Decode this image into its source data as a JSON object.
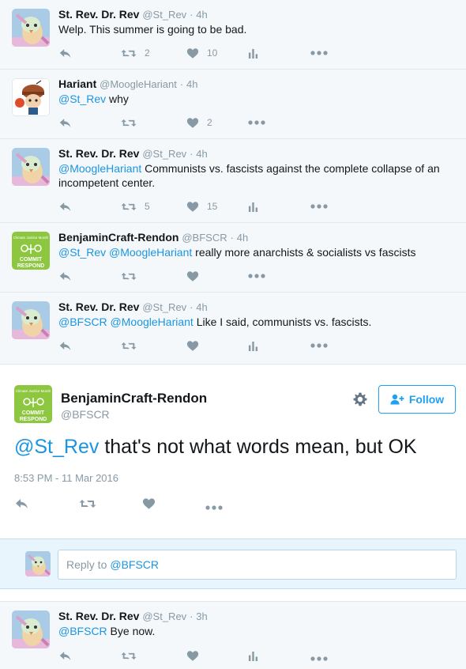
{
  "colors": {
    "link": "#1b95e0",
    "muted": "#8899a6",
    "follow": "#1da1f2",
    "background": "#f5f8fa"
  },
  "tweets_before": [
    {
      "avatar": "chick-avatar",
      "name": "St. Rev. Dr. Rev",
      "handle": "@St_Rev",
      "time": "4h",
      "mention": "",
      "text": "Welp. This summer is going to be bad.",
      "retweets": "2",
      "likes": "10",
      "analytics": true
    },
    {
      "avatar": "cartoon-avatar",
      "name": "Hariant",
      "handle": "@MoogleHariant",
      "time": "4h",
      "mention": "@St_Rev",
      "text": " why",
      "retweets": "",
      "likes": "2",
      "analytics": false
    },
    {
      "avatar": "chick-avatar",
      "name": "St. Rev. Dr. Rev",
      "handle": "@St_Rev",
      "time": "4h",
      "mention": "@MoogleHariant",
      "text": " Communists vs. fascists against the complete collapse of an incompetent center.",
      "retweets": "5",
      "likes": "15",
      "analytics": true
    },
    {
      "avatar": "cjw-avatar",
      "name": "BenjaminCraft-Rendon",
      "handle": "@BFSCR",
      "time": "4h",
      "mention": "@St_Rev @MoogleHariant",
      "text": " really more anarchists & socialists vs fascists",
      "retweets": "",
      "likes": "",
      "analytics": false
    },
    {
      "avatar": "chick-avatar",
      "name": "St. Rev. Dr. Rev",
      "handle": "@St_Rev",
      "time": "4h",
      "mention": "@BFSCR @MoogleHariant",
      "text": " Like I said, communists vs. fascists.",
      "retweets": "",
      "likes": "",
      "analytics": true
    }
  ],
  "focused": {
    "name": "BenjaminCraft-Rendon",
    "handle": "@BFSCR",
    "follow_label": "Follow",
    "mention": "@St_Rev",
    "text": " that's not what words mean, but OK",
    "timestamp": "8:53 PM - 11 Mar 2016",
    "logo_lines": [
      "Climate Justice Month",
      "COMMIT",
      "RESPOND"
    ]
  },
  "reply": {
    "prefix": "Reply to",
    "mention": "@BFSCR"
  },
  "tweet_after": {
    "name": "St. Rev. Dr. Rev",
    "handle": "@St_Rev",
    "time": "3h",
    "mention": "@BFSCR",
    "text": " Bye now."
  },
  "icons": [
    "reply-icon",
    "retweet-icon",
    "like-icon",
    "analytics-icon",
    "more-icon",
    "gear-icon",
    "follow-user-icon"
  ]
}
